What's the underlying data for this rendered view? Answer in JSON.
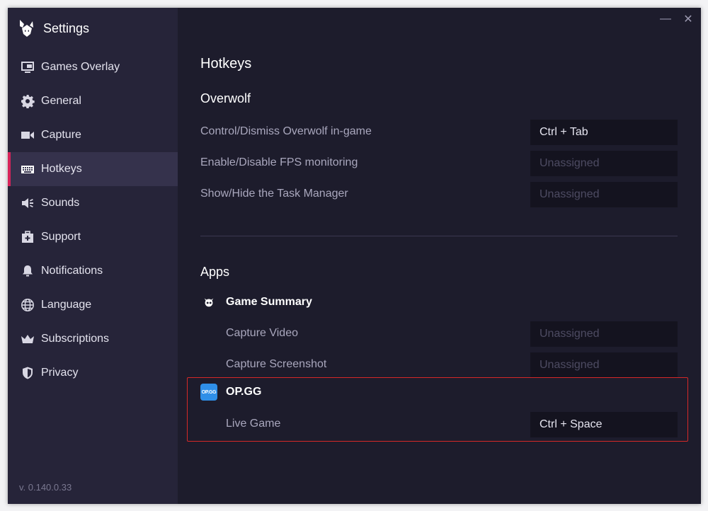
{
  "app": {
    "title": "Settings",
    "version": "v. 0.140.0.33"
  },
  "window_controls": {
    "minimize": "—",
    "close": "✕"
  },
  "sidebar": {
    "items": [
      {
        "label": "Games Overlay",
        "icon": "monitor-icon",
        "active": false
      },
      {
        "label": "General",
        "icon": "gear-icon",
        "active": false
      },
      {
        "label": "Capture",
        "icon": "video-camera-icon",
        "active": false
      },
      {
        "label": "Hotkeys",
        "icon": "keyboard-icon",
        "active": true
      },
      {
        "label": "Sounds",
        "icon": "speaker-icon",
        "active": false
      },
      {
        "label": "Support",
        "icon": "first-aid-icon",
        "active": false
      },
      {
        "label": "Notifications",
        "icon": "bell-icon",
        "active": false
      },
      {
        "label": "Language",
        "icon": "globe-icon",
        "active": false
      },
      {
        "label": "Subscriptions",
        "icon": "crown-icon",
        "active": false
      },
      {
        "label": "Privacy",
        "icon": "shield-icon",
        "active": false
      }
    ]
  },
  "main": {
    "title": "Hotkeys",
    "overwolf": {
      "heading": "Overwolf",
      "rows": [
        {
          "label": "Control/Dismiss Overwolf in-game",
          "value": "Ctrl + Tab",
          "placeholder": "Unassigned"
        },
        {
          "label": "Enable/Disable FPS monitoring",
          "value": "",
          "placeholder": "Unassigned"
        },
        {
          "label": "Show/Hide the Task Manager",
          "value": "",
          "placeholder": "Unassigned"
        }
      ]
    },
    "apps": {
      "heading": "Apps",
      "list": [
        {
          "name": "Game Summary",
          "icon": "game-summary-icon",
          "rows": [
            {
              "label": "Capture Video",
              "value": "",
              "placeholder": "Unassigned"
            },
            {
              "label": "Capture Screenshot",
              "value": "",
              "placeholder": "Unassigned"
            }
          ]
        },
        {
          "name": "OP.GG",
          "icon_text": "OP.GG",
          "rows": [
            {
              "label": "Live Game",
              "value": "Ctrl + Space",
              "placeholder": "Unassigned"
            }
          ]
        }
      ]
    }
  },
  "colors": {
    "accent": "#d6245a",
    "highlight_border": "#d62828",
    "sidebar_bg": "#262439",
    "content_bg": "#1d1c2c"
  }
}
